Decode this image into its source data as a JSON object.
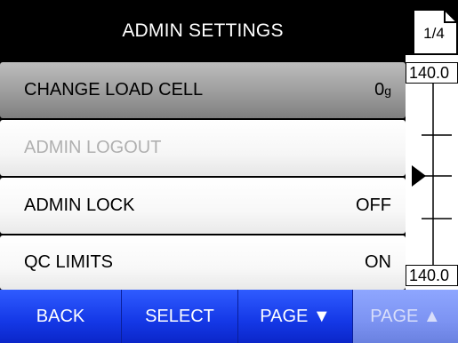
{
  "header": {
    "title": "ADMIN SETTINGS"
  },
  "page_indicator": {
    "text": "1/4"
  },
  "menu": {
    "items": [
      {
        "label": "CHANGE LOAD CELL",
        "value": "0",
        "unit": "g",
        "state": "selected"
      },
      {
        "label": "ADMIN LOGOUT",
        "value": "",
        "unit": "",
        "state": "disabled"
      },
      {
        "label": "ADMIN LOCK",
        "value": "OFF",
        "unit": "",
        "state": "normal"
      },
      {
        "label": "QC LIMITS",
        "value": "ON",
        "unit": "",
        "state": "normal"
      }
    ]
  },
  "gauge": {
    "top_label": "140.0",
    "bottom_label": "140.0"
  },
  "footer": {
    "buttons": [
      {
        "label": "BACK",
        "enabled": true
      },
      {
        "label": "SELECT",
        "enabled": true
      },
      {
        "label": "PAGE ▼",
        "enabled": true
      },
      {
        "label": "PAGE ▲",
        "enabled": false
      }
    ]
  },
  "colors": {
    "header_bg": "#000000",
    "selected_row": "#9c9c9c",
    "footer_blue": "#1438e6",
    "footer_disabled": "#7c93f2"
  }
}
